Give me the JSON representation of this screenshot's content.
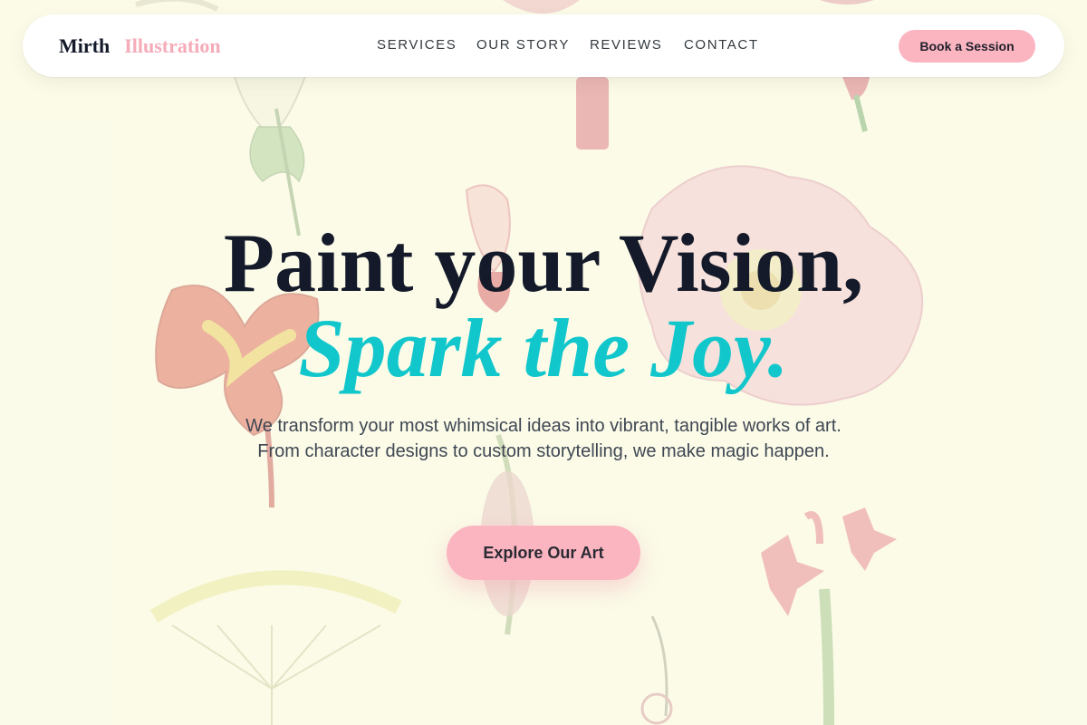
{
  "brand": {
    "name_primary": "Mirth",
    "name_accent": "Illustration"
  },
  "nav": {
    "links": [
      {
        "label": "SERVICES"
      },
      {
        "label": "OUR STORY"
      },
      {
        "label": "REVIEWS"
      },
      {
        "label": "CONTACT"
      }
    ],
    "cta_label": "Book a Session"
  },
  "hero": {
    "title_line1": "Paint your Vision,",
    "title_line2": "Spark the Joy.",
    "subtitle": "We transform your most whimsical ideas into vibrant, tangible works of art. From character designs to custom storytelling, we make magic happen.",
    "cta_label": "Explore Our Art"
  },
  "colors": {
    "background": "#fbfbe9",
    "accent_pink": "#fbb5c1",
    "accent_teal": "#12c7cc",
    "ink": "#141a2a"
  }
}
